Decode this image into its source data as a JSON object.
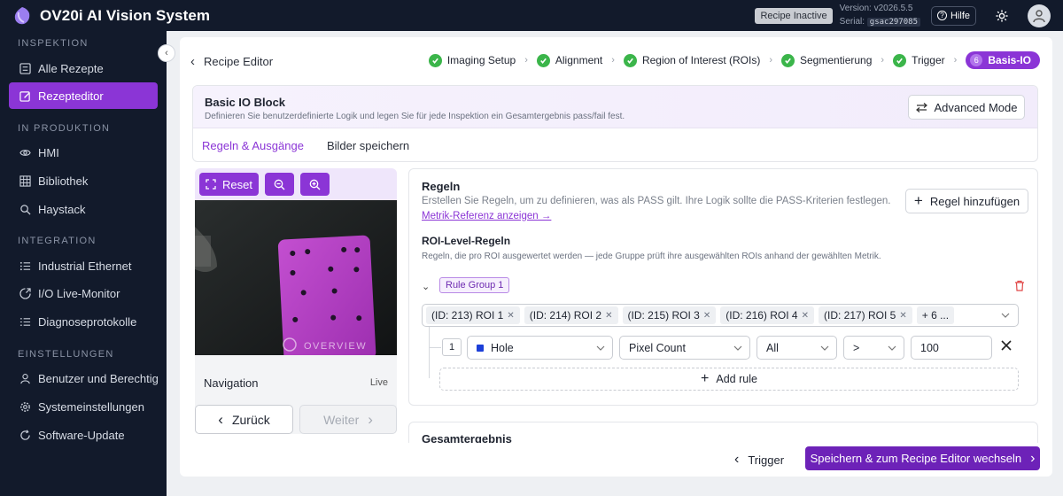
{
  "app": {
    "title": "OV20i AI Vision System",
    "status_badge": "Recipe Inactive",
    "version": "Version: v2026.5.5",
    "serial_label": "Serial:",
    "serial": "gsac297085",
    "help": "Hilfe"
  },
  "sidebar": {
    "sections": [
      {
        "title": "INSPEKTION",
        "items": [
          {
            "label": "Alle Rezepte",
            "icon": "list-icon"
          },
          {
            "label": "Rezepteditor",
            "icon": "edit-icon",
            "active": true
          }
        ]
      },
      {
        "title": "IN PRODUKTION",
        "items": [
          {
            "label": "HMI",
            "icon": "eye-icon"
          },
          {
            "label": "Bibliothek",
            "icon": "grid-icon"
          },
          {
            "label": "Haystack",
            "icon": "search-icon"
          }
        ]
      },
      {
        "title": "INTEGRATION",
        "items": [
          {
            "label": "Industrial Ethernet",
            "icon": "network-icon"
          },
          {
            "label": "I/O Live-Monitor",
            "icon": "io-icon"
          },
          {
            "label": "Diagnoseprotokolle",
            "icon": "log-icon"
          }
        ]
      },
      {
        "title": "EINSTELLUNGEN",
        "items": [
          {
            "label": "Benutzer und Berechtigungen",
            "icon": "user-icon"
          },
          {
            "label": "Systemeinstellungen",
            "icon": "gear-icon"
          },
          {
            "label": "Software-Update",
            "icon": "refresh-icon"
          }
        ]
      }
    ]
  },
  "editor": {
    "breadcrumb": "Recipe Editor",
    "steps": [
      "Imaging Setup",
      "Alignment",
      "Region of Interest (ROIs)",
      "Segmentierung",
      "Trigger"
    ],
    "active_step": {
      "num": "6",
      "label": "Basis-IO"
    },
    "block_title": "Basic IO Block",
    "block_desc": "Definieren Sie benutzerdefinierte Logik und legen Sie für jede Inspektion ein Gesamtergebnis pass/fail fest.",
    "advanced": "Advanced Mode",
    "tabs": [
      "Regeln & Ausgänge",
      "Bilder speichern"
    ]
  },
  "camera": {
    "reset": "Reset",
    "watermark": "OVERVIEW",
    "nav_label": "Navigation",
    "nav_status": "Live",
    "back": "Zurück",
    "next": "Weiter"
  },
  "rules": {
    "title": "Regeln",
    "desc": "Erstellen Sie Regeln, um zu definieren, was als PASS gilt. Ihre Logik sollte die PASS-Kriterien festlegen.",
    "link": "Metrik-Referenz anzeigen →",
    "add": "Regel hinzufügen",
    "roi_title": "ROI-Level-Regeln",
    "roi_desc": "Regeln, die pro ROI ausgewertet werden — jede Gruppe prüft ihre ausgewählten ROIs anhand der gewählten Metrik.",
    "group": "Rule Group 1",
    "chips": [
      "(ID: 213) ROI 1",
      "(ID: 214) ROI 2",
      "(ID: 215) ROI 3",
      "(ID: 216) ROI 4",
      "(ID: 217) ROI 5"
    ],
    "more": "+ 6 ...",
    "rule": {
      "index": "1",
      "class": "Hole",
      "class_color": "#1c3fd8",
      "metric": "Pixel Count",
      "scope": "All",
      "op": ">",
      "value": "100"
    },
    "add_rule": "Add rule",
    "gesamt": "Gesamtergebnis"
  },
  "footer": {
    "trigger": "Trigger",
    "save": "Speichern & zum Recipe Editor wechseln"
  }
}
